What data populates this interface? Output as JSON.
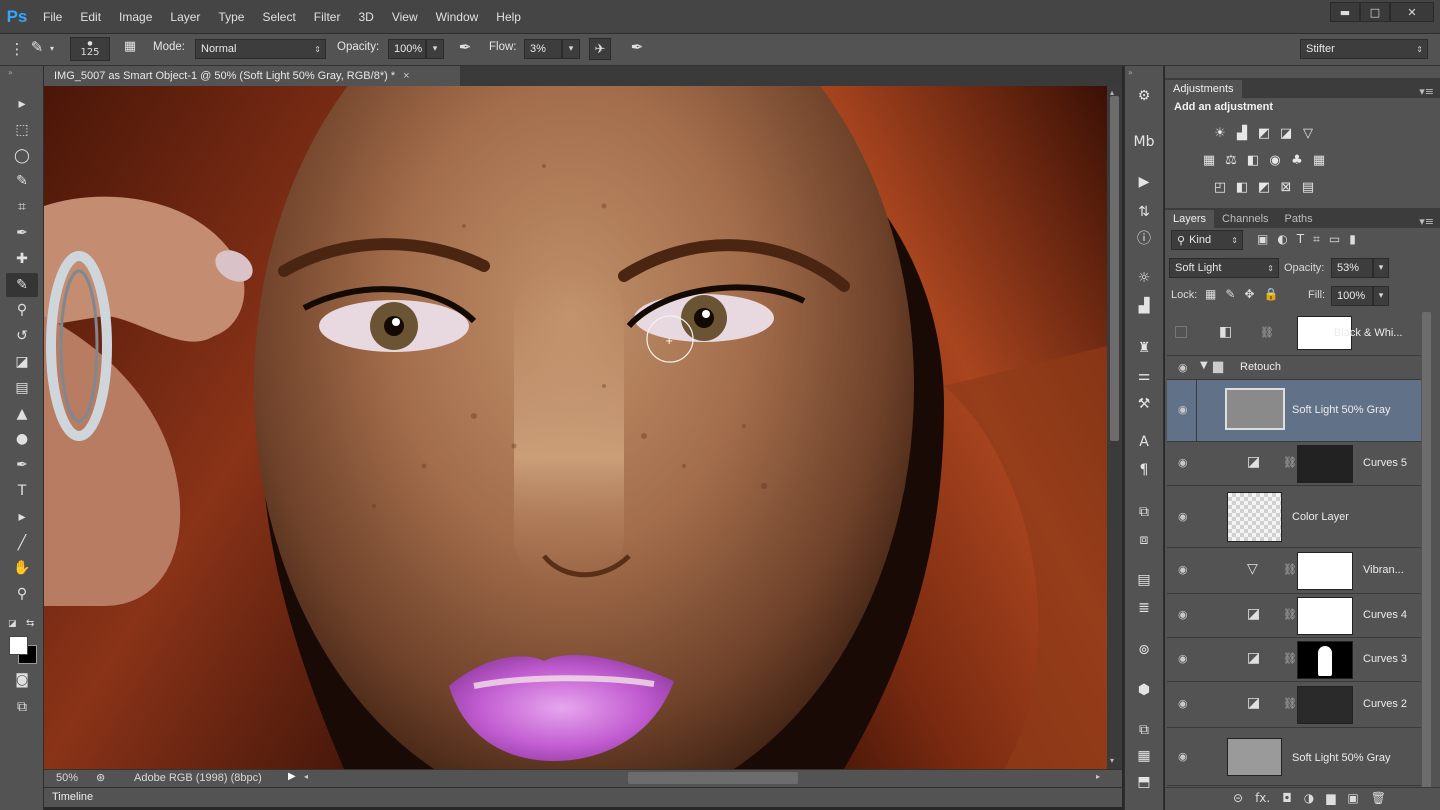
{
  "app": {
    "logo": "Ps",
    "accent": "#31a8ff"
  },
  "menu": [
    "File",
    "Edit",
    "Image",
    "Layer",
    "Type",
    "Select",
    "Filter",
    "3D",
    "View",
    "Window",
    "Help"
  ],
  "window_controls": {
    "minimize": "▬",
    "maximize": "□",
    "close": "✕"
  },
  "options": {
    "brush_size": "125",
    "mode_label": "Mode:",
    "mode_value": "Normal",
    "opacity_label": "Opacity:",
    "opacity_value": "100%",
    "flow_label": "Flow:",
    "flow_value": "3%",
    "workspace": "Stifter"
  },
  "document": {
    "tab_title": "IMG_5007 as Smart Object-1 @ 50% (Soft Light 50% Gray, RGB/8*) *",
    "tab_close": "×",
    "zoom": "50%",
    "color_profile": "Adobe RGB (1998) (8bpc)"
  },
  "timeline_label": "Timeline",
  "tools": [
    "move-tool",
    "marquee-tool",
    "lasso-tool",
    "quick-select-tool",
    "crop-tool",
    "eyedropper-tool",
    "healing-brush-tool",
    "brush-tool",
    "clone-stamp-tool",
    "history-brush-tool",
    "eraser-tool",
    "gradient-tool",
    "blur-tool",
    "dodge-tool",
    "pen-tool",
    "type-tool",
    "path-select-tool",
    "line-tool",
    "hand-tool",
    "zoom-tool"
  ],
  "tool_glyphs": [
    "▸",
    "⬚",
    "◯",
    "✎",
    "⌗",
    "✒",
    "✚",
    "✎",
    "⚲",
    "↺",
    "◪",
    "▤",
    "▲",
    "●",
    "✒",
    "T",
    "▸",
    "╱",
    "✋",
    "⚲"
  ],
  "adjustments": {
    "tab": "Adjustments",
    "heading": "Add an adjustment",
    "row1": [
      "☀",
      "▟",
      "◩",
      "◪",
      "▽"
    ],
    "row2": [
      "▦",
      "⚖",
      "◧",
      "◉",
      "♣",
      "▦"
    ],
    "row3": [
      "◰",
      "◧",
      "◩",
      "⊠",
      "▤"
    ]
  },
  "layers_panel": {
    "tabs": [
      "Layers",
      "Channels",
      "Paths"
    ],
    "filter_label": "Kind",
    "blend_mode": "Soft Light",
    "opacity_label": "Opacity:",
    "opacity_value": "53%",
    "lock_label": "Lock:",
    "fill_label": "Fill:",
    "fill_value": "100%",
    "layers": [
      {
        "name": "Black & Whi...",
        "visible": false
      },
      {
        "name": "Retouch",
        "visible": true
      },
      {
        "name": "Soft Light 50% Gray",
        "visible": true,
        "selected": true
      },
      {
        "name": "Curves 5",
        "visible": true
      },
      {
        "name": "Color Layer",
        "visible": true
      },
      {
        "name": "Vibran...",
        "visible": true
      },
      {
        "name": "Curves 4",
        "visible": true
      },
      {
        "name": "Curves 3",
        "visible": true
      },
      {
        "name": "Curves 2",
        "visible": true
      },
      {
        "name": "Soft Light 50% Gray",
        "visible": true
      }
    ],
    "footer_icons": [
      "link-icon",
      "fx-icon",
      "mask-icon",
      "adjustment-icon",
      "folder-icon",
      "new-layer-icon",
      "trash-icon"
    ],
    "footer_glyphs": [
      "⊝",
      "fx.",
      "◘",
      "◑",
      "▆",
      "▣",
      "🗑"
    ]
  },
  "dock_glyphs": [
    "⚙",
    "Mb",
    "▶",
    "⇅",
    "ⓘ",
    "☼",
    "▟",
    "♜",
    "⚌",
    "⚒",
    "A",
    "¶",
    "⧉",
    "⧈",
    "▤",
    "≣",
    "⊚",
    "⬢",
    "⧉",
    "▦",
    "⬒"
  ]
}
